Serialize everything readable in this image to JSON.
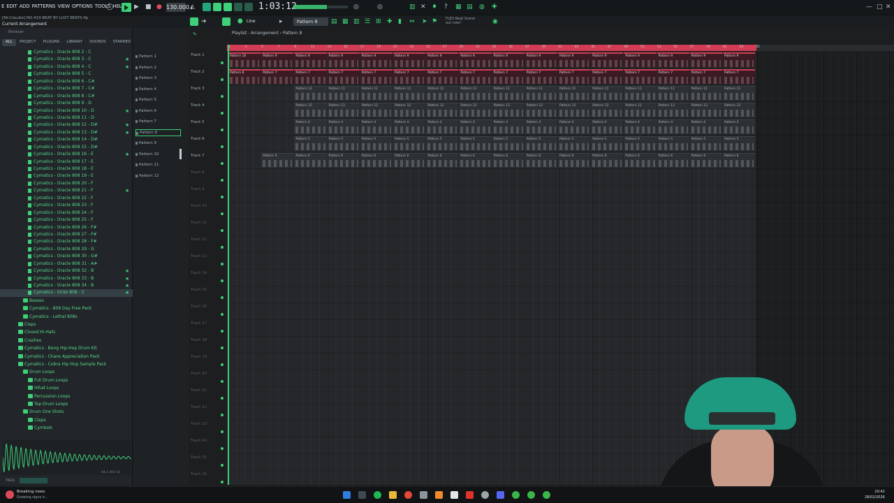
{
  "menu": {
    "items": [
      "E",
      "EDIT",
      "ADD",
      "PATTERNS",
      "VIEW",
      "OPTIONS",
      "TOOLS",
      "HELP"
    ]
  },
  "transport": {
    "bpm": "130.000",
    "time": "1:03:12"
  },
  "project": {
    "line1": "[Mr.Claudio] NO 419 BEAT BY LUZY BEATS.flp",
    "line2": "Current Arrangement"
  },
  "toolbar2": {
    "pattern_selector": "Pattern 8",
    "snap": "Line",
    "flex_label": "FLEX Beat Scene",
    "flex_sub": "out now!"
  },
  "browser": {
    "title": "Browser",
    "tabs": [
      "ALL",
      "PROJECT",
      "PLUGINS",
      "LIBRARY",
      "SOUNDS",
      "STARRED"
    ],
    "samples": [
      {
        "label": "Cymatics - Oracle 808 2 - C",
        "star": false
      },
      {
        "label": "Cymatics - Oracle 808 3 - C",
        "star": true
      },
      {
        "label": "Cymatics - Oracle 808 4 - C",
        "star": true
      },
      {
        "label": "Cymatics - Oracle 808 5 - C",
        "star": false
      },
      {
        "label": "Cymatics - Oracle 808 6 - C#",
        "star": false
      },
      {
        "label": "Cymatics - Oracle 808 7 - C#",
        "star": false
      },
      {
        "label": "Cymatics - Oracle 808 8 - C#",
        "star": false
      },
      {
        "label": "Cymatics - Oracle 808 9 - D",
        "star": false
      },
      {
        "label": "Cymatics - Oracle 808 10 - D",
        "star": true
      },
      {
        "label": "Cymatics - Oracle 808 11 - D",
        "star": false
      },
      {
        "label": "Cymatics - Oracle 808 12 - D#",
        "star": true
      },
      {
        "label": "Cymatics - Oracle 808 13 - D#",
        "star": true
      },
      {
        "label": "Cymatics - Oracle 808 14 - D#",
        "star": false
      },
      {
        "label": "Cymatics - Oracle 808 15 - D#",
        "star": false
      },
      {
        "label": "Cymatics - Oracle 808 16 - E",
        "star": true
      },
      {
        "label": "Cymatics - Oracle 808 17 - E",
        "star": false
      },
      {
        "label": "Cymatics - Oracle 808 18 - E",
        "star": false
      },
      {
        "label": "Cymatics - Oracle 808 19 - E",
        "star": false
      },
      {
        "label": "Cymatics - Oracle 808 20 - F",
        "star": false
      },
      {
        "label": "Cymatics - Oracle 808 21 - F",
        "star": true
      },
      {
        "label": "Cymatics - Oracle 808 22 - F",
        "star": false
      },
      {
        "label": "Cymatics - Oracle 808 23 - F",
        "star": false
      },
      {
        "label": "Cymatics - Oracle 808 24 - F",
        "star": false
      },
      {
        "label": "Cymatics - Oracle 808 25 - F",
        "star": false
      },
      {
        "label": "Cymatics - Oracle 808 26 - F#",
        "star": false
      },
      {
        "label": "Cymatics - Oracle 808 27 - F#",
        "star": false
      },
      {
        "label": "Cymatics - Oracle 808 28 - F#",
        "star": false
      },
      {
        "label": "Cymatics - Oracle 808 29 - G",
        "star": false
      },
      {
        "label": "Cymatics - Oracle 808 30 - G#",
        "star": false
      },
      {
        "label": "Cymatics - Oracle 808 31 - A#",
        "star": false
      },
      {
        "label": "Cymatics - Oracle 808 32 - B",
        "star": true
      },
      {
        "label": "Cymatics - Oracle 808 33 - B",
        "star": true
      },
      {
        "label": "Cymatics - Oracle 808 34 - B",
        "star": true
      },
      {
        "label": "Cymatics - Sicko 808 - C",
        "star": true
      }
    ],
    "folders": [
      {
        "label": "Basses",
        "indent": 1
      },
      {
        "label": "Cymatics - 808 Day Free Pack",
        "indent": 1
      },
      {
        "label": "Cymatics - Lethal 808s",
        "indent": 1
      },
      {
        "label": "Claps",
        "indent": 0
      },
      {
        "label": "Closed Hi-Hats",
        "indent": 0
      },
      {
        "label": "Crashes",
        "indent": 0
      },
      {
        "label": "Cymatics - Bang Hip-Hop Drum Kit",
        "indent": 0
      },
      {
        "label": "Cymatics - Chaos Appreciation Pack",
        "indent": 0
      },
      {
        "label": "Cymatics - Cobra Hip Hop Sample Pack",
        "indent": 0
      },
      {
        "label": "Drum Loops",
        "indent": 1
      },
      {
        "label": "Full Drum Loops",
        "indent": 2
      },
      {
        "label": "Hihat Loops",
        "indent": 2
      },
      {
        "label": "Percussion Loops",
        "indent": 2
      },
      {
        "label": "Top Drum Loops",
        "indent": 2
      },
      {
        "label": "Drum One Shots",
        "indent": 1
      },
      {
        "label": "Claps",
        "indent": 2
      },
      {
        "label": "Cymbals",
        "indent": 2
      }
    ],
    "wave_info": "44.1 kHz 32",
    "tags_label": "TAGS"
  },
  "patterns": [
    "Pattern 1",
    "Pattern 2",
    "Pattern 3",
    "Pattern 4",
    "Pattern 5",
    "Pattern 6",
    "Pattern 7",
    "Pattern 8",
    "Pattern 9",
    "Pattern 10",
    "Pattern 11",
    "Pattern 12"
  ],
  "selected_pattern_index": 7,
  "playlist": {
    "title": "Playlist - Arrangement › Pattern 8",
    "bar_numbers": [
      "1",
      "3",
      "5",
      "7",
      "9",
      "11",
      "13",
      "15",
      "17",
      "19",
      "21",
      "23",
      "25",
      "27",
      "29",
      "31",
      "33",
      "35",
      "37",
      "39",
      "41",
      "43",
      "45",
      "47",
      "49",
      "51",
      "53",
      "55",
      "57",
      "59",
      "61",
      "63",
      "65"
    ],
    "tracks": [
      "Track 1",
      "Track 2",
      "Track 3",
      "Track 4",
      "Track 5",
      "Track 6",
      "Track 7",
      "Track 8",
      "Track 9",
      "Track 10",
      "Track 11",
      "Track 12",
      "Track 13",
      "Track 14",
      "Track 15",
      "Track 16",
      "Track 17",
      "Track 18",
      "Track 19",
      "Track 20",
      "Track 21",
      "Track 22",
      "Track 23",
      "Track 24",
      "Track 25",
      "Track 26"
    ],
    "active_track_count": 7,
    "clip_rows": [
      {
        "track": 0,
        "color": "red",
        "start": 1,
        "end": 65,
        "first": "Pattern 10",
        "rest": "Pattern 9",
        "first_len": 4
      },
      {
        "track": 1,
        "color": "red",
        "start": 1,
        "end": 65,
        "first": "Pattern 8",
        "rest": "Pattern 7",
        "first_len": 4
      },
      {
        "track": 2,
        "color": "gray",
        "start": 9,
        "end": 65,
        "first": "Pattern 12",
        "rest": "Pattern 11",
        "first_len": 4
      },
      {
        "track": 3,
        "color": "gray",
        "start": 9,
        "end": 65,
        "first": "Pattern 12",
        "rest": "Pattern 12",
        "first_len": 4
      },
      {
        "track": 4,
        "color": "gray",
        "start": 9,
        "end": 65,
        "first": "Pattern 4",
        "rest": "Pattern 4",
        "first_len": 4
      },
      {
        "track": 5,
        "color": "gray",
        "start": 9,
        "end": 65,
        "first": "Pattern 5",
        "rest": "Pattern 5",
        "first_len": 4
      },
      {
        "track": 6,
        "color": "gray",
        "start": 5,
        "end": 65,
        "first": "Pattern 6",
        "rest": "Pattern 6",
        "first_len": 4
      }
    ]
  },
  "taskbar": {
    "news_title": "Breaking news",
    "news_sub": "Growing signs ir...",
    "time": "20:42",
    "date": "28/02/2026"
  },
  "colors": {
    "accent": "#3fd07a",
    "clip_red": "#d23c54",
    "background": "#1c1e20"
  }
}
